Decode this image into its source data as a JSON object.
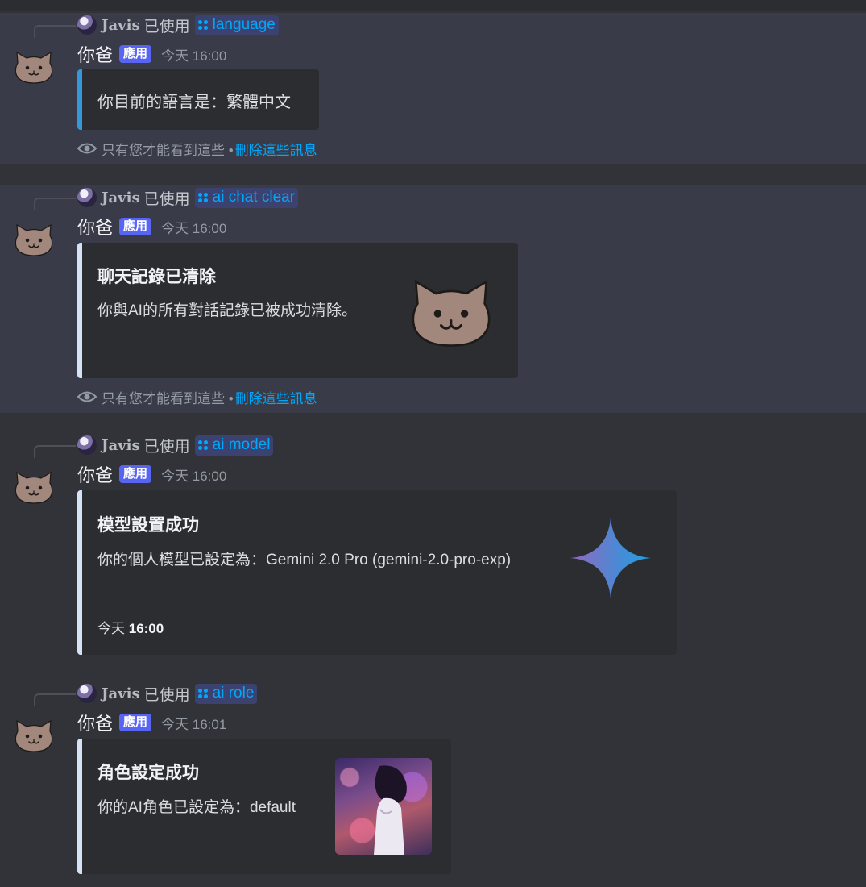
{
  "bot": {
    "name": "你爸",
    "tag": "應用",
    "avatar": "cat-avatar"
  },
  "ephemeral": {
    "notice": "只有您才能看到這些 •",
    "delete_label": "刪除這些訊息",
    "icon": "eye-icon"
  },
  "messages": [
    {
      "reply_user": "Javis",
      "reply_used": "已使用",
      "command": "language",
      "time": "今天 16:00",
      "embed": {
        "description": "你目前的語言是：繁體中文",
        "accent": "#3498db"
      }
    },
    {
      "reply_user": "Javis",
      "reply_used": "已使用",
      "command": "ai chat clear",
      "time": "今天 16:00",
      "embed": {
        "title": "聊天記錄已清除",
        "description": "你與AI的所有對話記錄已被成功清除。",
        "thumbnail": "cat-face-icon",
        "accent": "#d6e2f6"
      }
    },
    {
      "reply_user": "Javis",
      "reply_used": "已使用",
      "command": "ai model",
      "time": "今天 16:00",
      "embed": {
        "title": "模型設置成功",
        "description": "你的個人模型已設定為：Gemini 2.0 Pro (gemini-2.0-pro-exp)",
        "footer_prefix": "今天",
        "footer_time": "16:00",
        "thumbnail": "gemini-sparkle-icon",
        "accent": "#d6e2f6"
      }
    },
    {
      "reply_user": "Javis",
      "reply_used": "已使用",
      "command": "ai role",
      "time": "今天 16:01",
      "embed": {
        "title": "角色設定成功",
        "description": "你的AI角色已設定為：default",
        "thumbnail": "anime-girl-image",
        "accent": "#d6e2f6"
      }
    }
  ],
  "colors": {
    "background": "#313338",
    "ephemeral_bg": "#393b48",
    "embed_bg": "#2b2d31",
    "link": "#00a8fc",
    "app_tag": "#5865f2"
  }
}
